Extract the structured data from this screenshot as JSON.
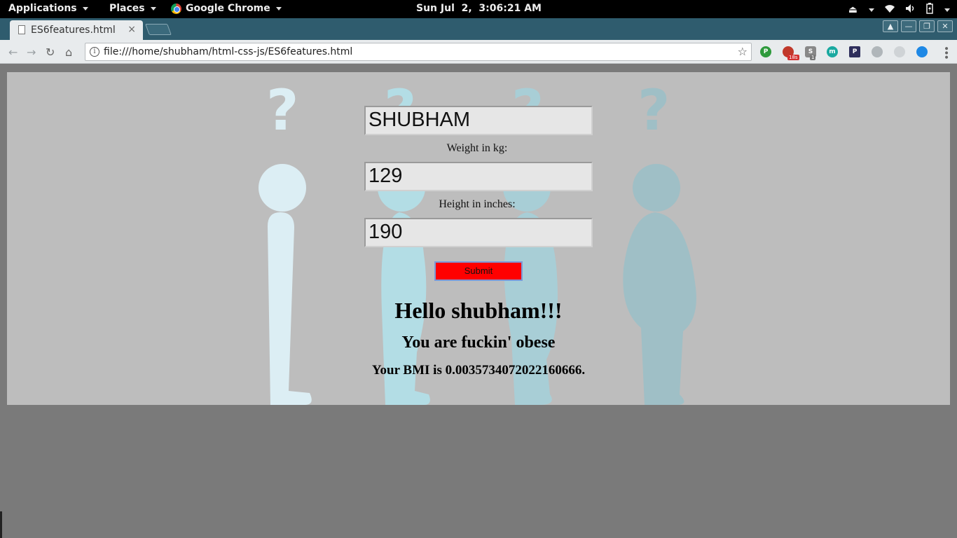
{
  "topbar": {
    "applications": "Applications",
    "places": "Places",
    "app_name": "Google Chrome",
    "clock": "Sun Jul  2,  3:06:21 AM"
  },
  "browser": {
    "tab_title": "ES6features.html",
    "tab_close": "×",
    "url": "file:///home/shubham/html-css-js/ES6features.html",
    "extensions": [
      {
        "icon": "pushbullet-icon",
        "color": "#2e9a3c",
        "glyph": "P"
      },
      {
        "icon": "extension-icon",
        "color": "#c0392b",
        "glyph": "",
        "badge": "18s"
      },
      {
        "icon": "session-icon",
        "color": "#888888",
        "glyph": "S",
        "badge": "1"
      },
      {
        "icon": "mercury-icon",
        "color": "#1aa9a0",
        "glyph": "m"
      },
      {
        "icon": "pocket-icon",
        "color": "#2e2e5c",
        "glyph": "P"
      },
      {
        "icon": "diamond-icon",
        "color": "#b0b6ba",
        "glyph": ""
      },
      {
        "icon": "circle-icon",
        "color": "#cfd3d6",
        "glyph": ""
      },
      {
        "icon": "blue-circle-icon",
        "color": "#1e88e5",
        "glyph": ""
      }
    ]
  },
  "form": {
    "name_value": "SHUBHAM",
    "weight_label": "Weight in kg:",
    "weight_value": "129",
    "height_label": "Height in inches:",
    "height_value": "190",
    "submit_label": "Submit"
  },
  "result": {
    "greeting": "Hello shubham!!!",
    "verdict": "You are fuckin' obese",
    "bmi_text": "Your BMI is 0.0035734072022160666."
  },
  "colors": {
    "submit_bg": "#ff0000",
    "page_bg": "#bdbdbd",
    "figure_light": "#dceef4",
    "figure_mid": "#b3dde5",
    "figure_dark": "#9fbfc6"
  }
}
